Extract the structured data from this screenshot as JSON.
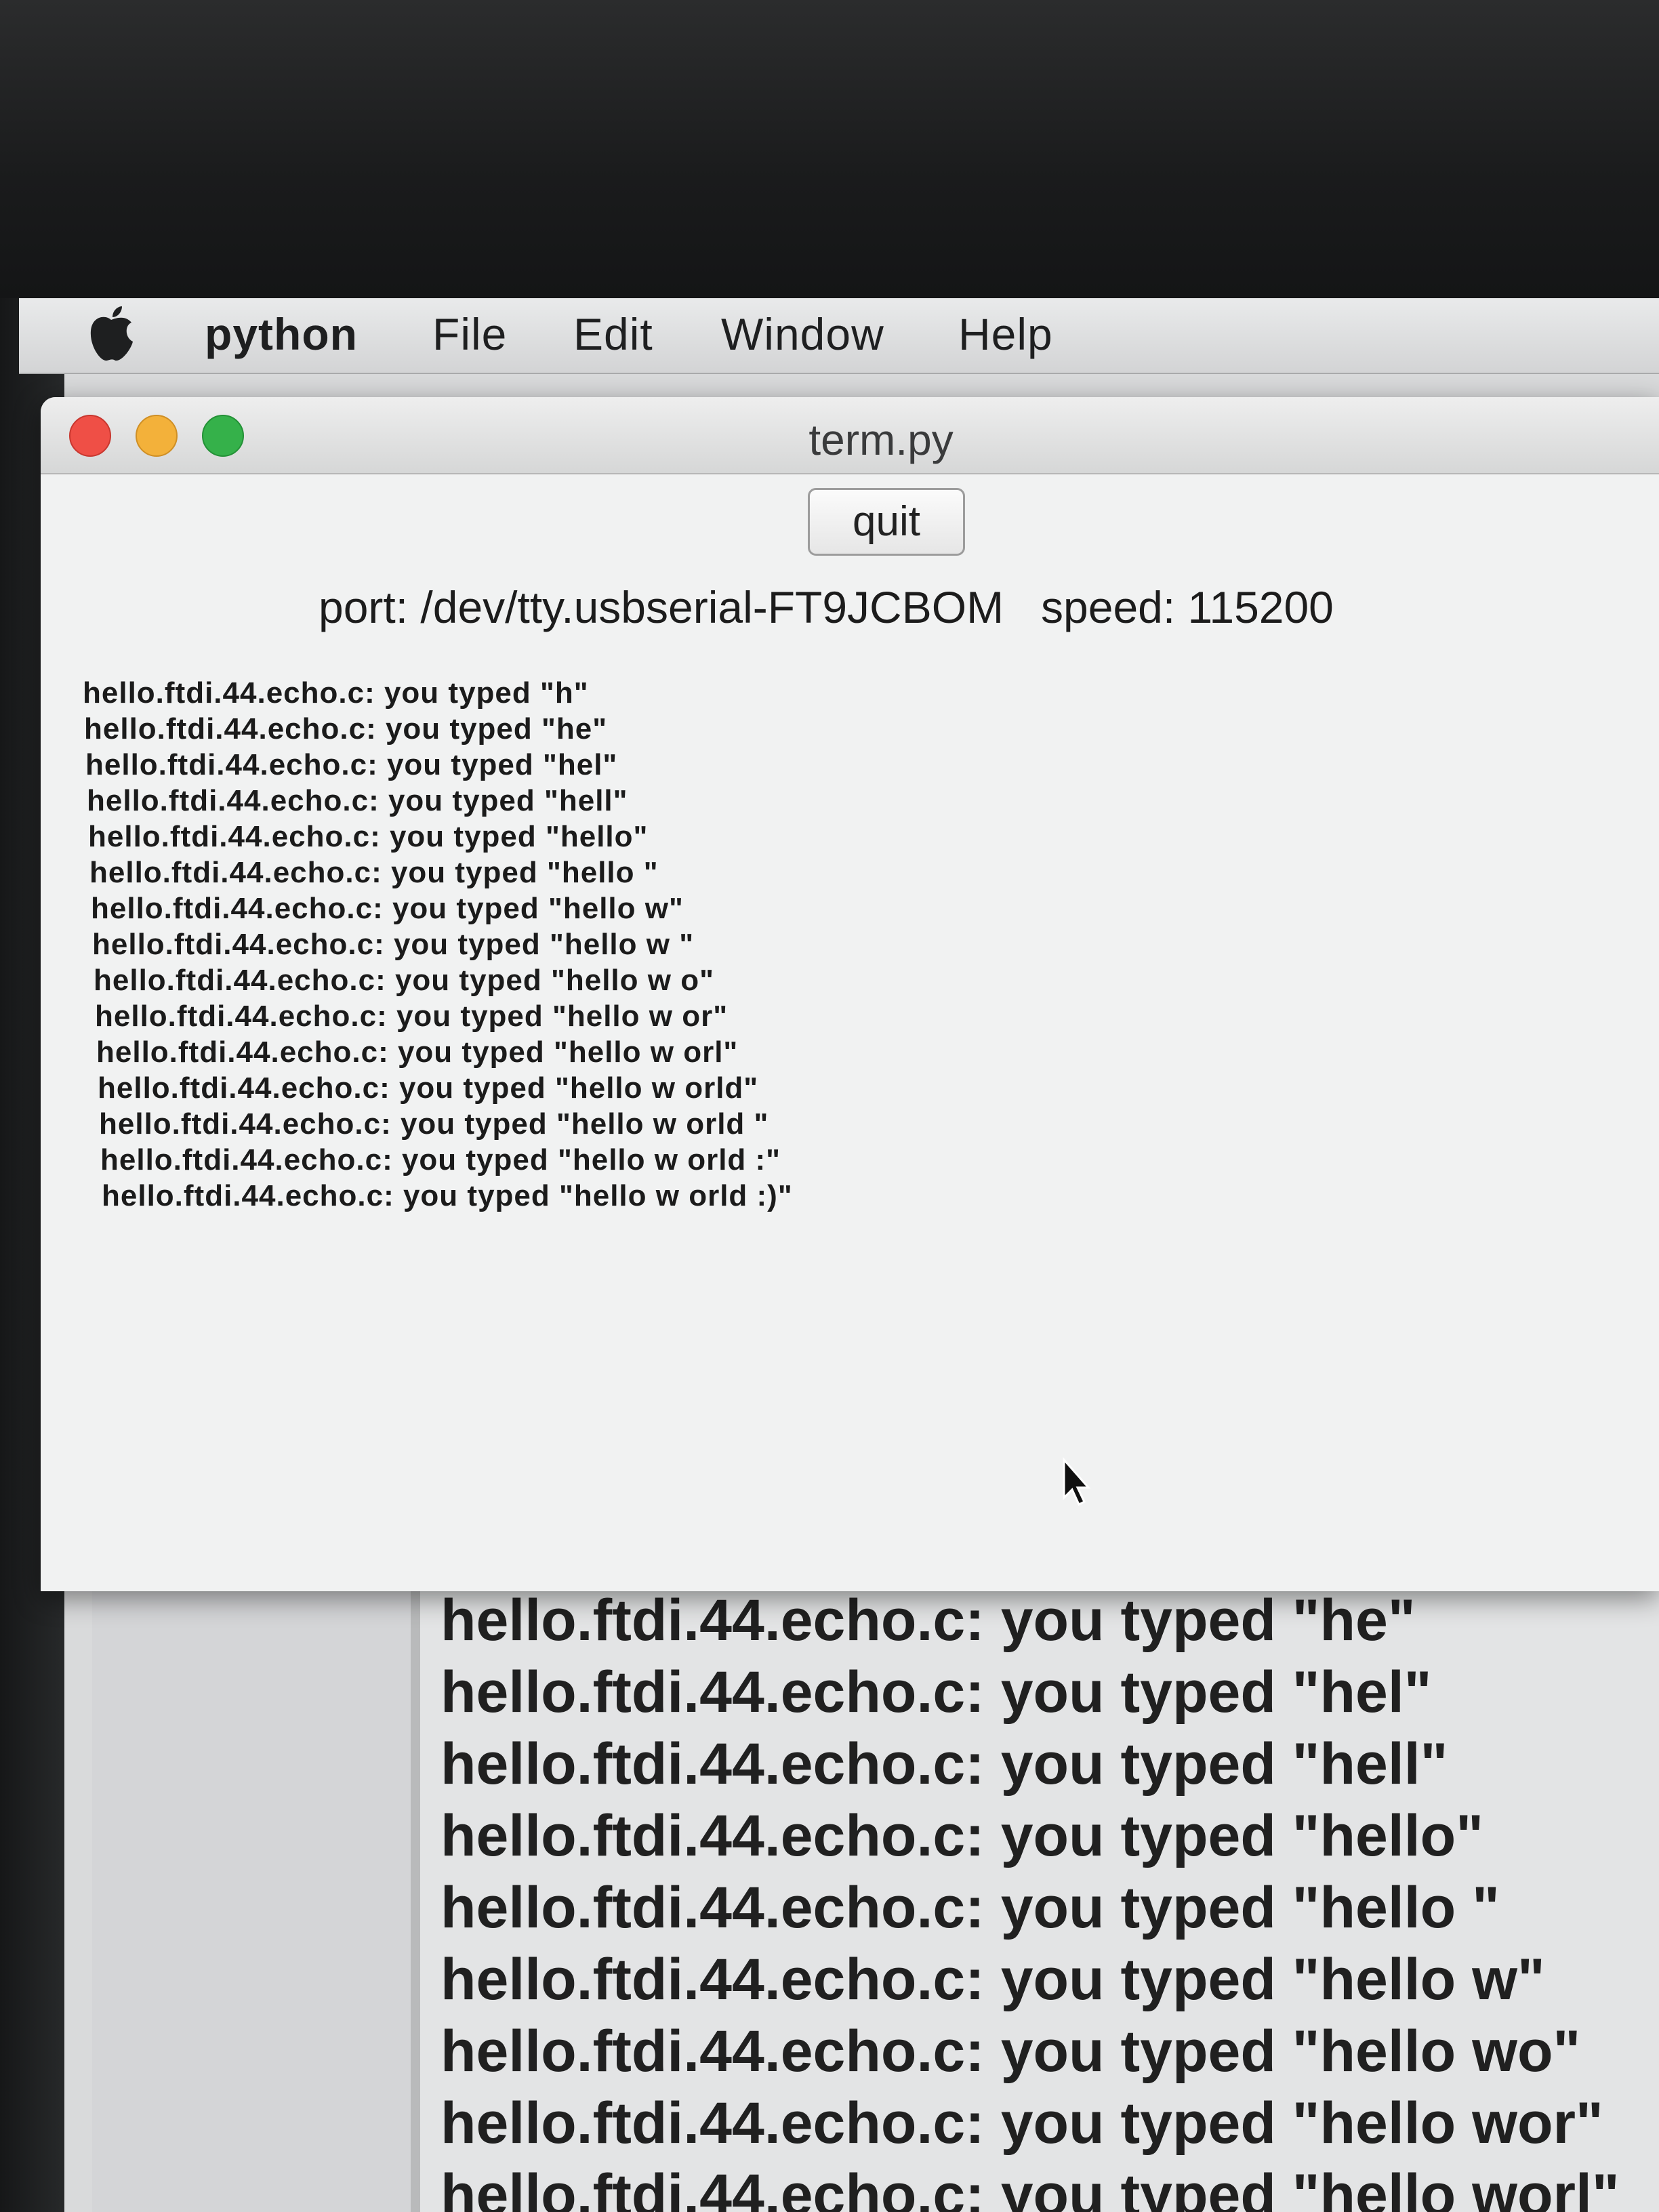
{
  "menubar": {
    "app": "python",
    "items": [
      "File",
      "Edit",
      "Window",
      "Help"
    ]
  },
  "window": {
    "title": "term.py",
    "quit_label": "quit",
    "status": "port: /dev/tty.usbserial-FT9JCBOM   speed: 115200"
  },
  "terminal": {
    "lines": [
      "hello.ftdi.44.echo.c: you typed \"h\"",
      "hello.ftdi.44.echo.c: you typed \"he\"",
      "hello.ftdi.44.echo.c: you typed \"hel\"",
      "hello.ftdi.44.echo.c: you typed \"hell\"",
      "hello.ftdi.44.echo.c: you typed \"hello\"",
      "hello.ftdi.44.echo.c: you typed \"hello \"",
      "hello.ftdi.44.echo.c: you typed \"hello w\"",
      "hello.ftdi.44.echo.c: you typed \"hello w \"",
      "hello.ftdi.44.echo.c: you typed \"hello w o\"",
      "hello.ftdi.44.echo.c: you typed \"hello w or\"",
      "hello.ftdi.44.echo.c: you typed \"hello w orl\"",
      "hello.ftdi.44.echo.c: you typed \"hello w orld\"",
      "hello.ftdi.44.echo.c: you typed \"hello w orld \"",
      "hello.ftdi.44.echo.c: you typed \"hello w orld :\"",
      "hello.ftdi.44.echo.c: you typed \"hello w orld :)\""
    ]
  },
  "background_terminal": {
    "lines": [
      "hello.ftdi.44.echo.c: you typed \"he\"",
      "hello.ftdi.44.echo.c: you typed \"hel\"",
      "hello.ftdi.44.echo.c: you typed \"hell\"",
      "hello.ftdi.44.echo.c: you typed \"hello\"",
      "hello.ftdi.44.echo.c: you typed \"hello \"",
      "hello.ftdi.44.echo.c: you typed \"hello w\"",
      "hello.ftdi.44.echo.c: you typed \"hello wo\"",
      "hello.ftdi.44.echo.c: you typed \"hello wor\"",
      "hello.ftdi.44.echo.c: you typed \"hello worl\""
    ]
  },
  "colors": {
    "close": "#ef4f46",
    "minimize": "#f3b13a",
    "zoom": "#35b14a"
  },
  "icons": {
    "apple": "apple-logo-icon",
    "pointer": "mouse-pointer-icon"
  }
}
